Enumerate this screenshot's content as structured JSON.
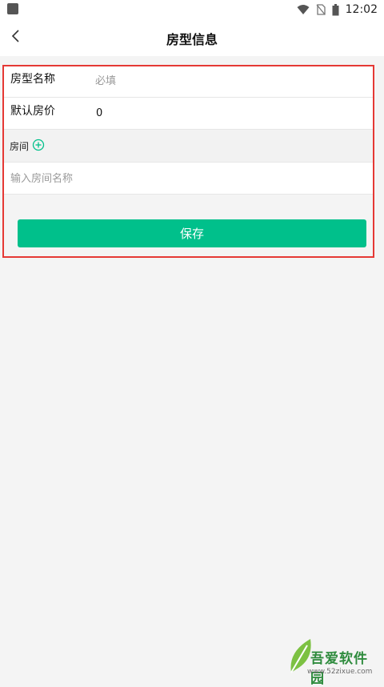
{
  "status_bar": {
    "time": "12:02",
    "icons": [
      "app-icon",
      "wifi-icon",
      "no-sim-icon",
      "battery-icon"
    ]
  },
  "nav": {
    "title": "房型信息",
    "back_icon": "chevron-left-icon"
  },
  "form": {
    "name_label": "房型名称",
    "name_placeholder": "必填",
    "price_label": "默认房价",
    "price_value": "0",
    "rooms_label": "房间",
    "add_icon": "plus-circle-icon",
    "room_placeholder": "输入房间名称",
    "save_label": "保存"
  },
  "watermark": {
    "text": "吾爱软件园",
    "url": "www.52zixue.com"
  },
  "colors": {
    "accent": "#00c08b",
    "highlight_border": "#e53935"
  }
}
